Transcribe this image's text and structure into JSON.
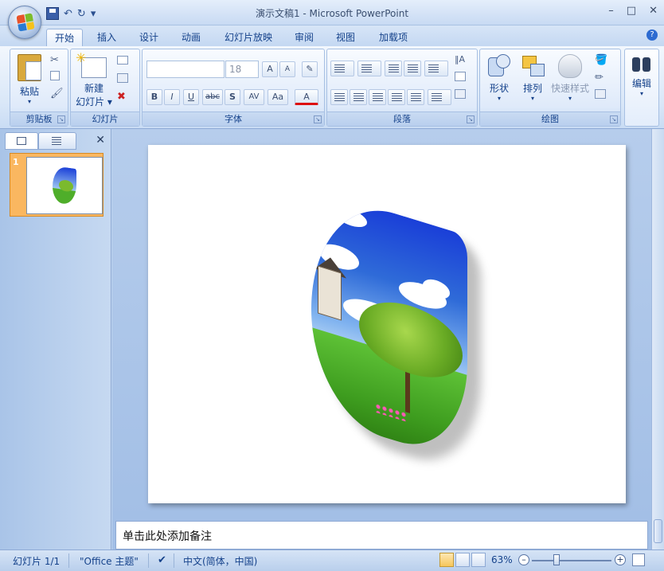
{
  "window": {
    "title": "演示文稿1 - Microsoft PowerPoint",
    "qat_undo_glyph": "↶",
    "qat_redo_glyph": "↻",
    "qat_more_glyph": "▾",
    "minimize": "–",
    "maximize": "□",
    "close": "✕"
  },
  "tabs": [
    "开始",
    "插入",
    "设计",
    "动画",
    "幻灯片放映",
    "审阅",
    "视图",
    "加载项"
  ],
  "help": "?",
  "ribbon": {
    "clipboard": {
      "label": "剪贴板",
      "paste": "粘贴"
    },
    "slides": {
      "label": "幻灯片",
      "new_slide_line1": "新建",
      "new_slide_line2": "幻灯片 ▾"
    },
    "font": {
      "label": "字体",
      "font_name": "",
      "font_size": "18",
      "bold": "B",
      "italic": "I",
      "underline": "U",
      "strike": "abc",
      "shadow": "S",
      "spacing": "AV",
      "case": "Aa",
      "color": "A",
      "grow": "A",
      "shrink": "A"
    },
    "paragraph": {
      "label": "段落"
    },
    "drawing": {
      "label": "绘图",
      "shapes": "形状",
      "arrange": "排列",
      "quick_styles": "快速样式"
    },
    "editing": {
      "label": "编辑"
    },
    "launcher_glyph": "↘",
    "dropdown_glyph": "▾"
  },
  "left_pane": {
    "close": "✕",
    "slide_number": "1"
  },
  "notes": {
    "placeholder": "单击此处添加备注"
  },
  "statusbar": {
    "slide": "幻灯片 1/1",
    "theme": "\"Office 主题\"",
    "language": "中文(简体，中国)",
    "zoom": "63%",
    "zoom_minus": "–",
    "zoom_plus": "+"
  },
  "colors": {
    "accent": "#15428b",
    "thumb_selected": "#fab760"
  }
}
